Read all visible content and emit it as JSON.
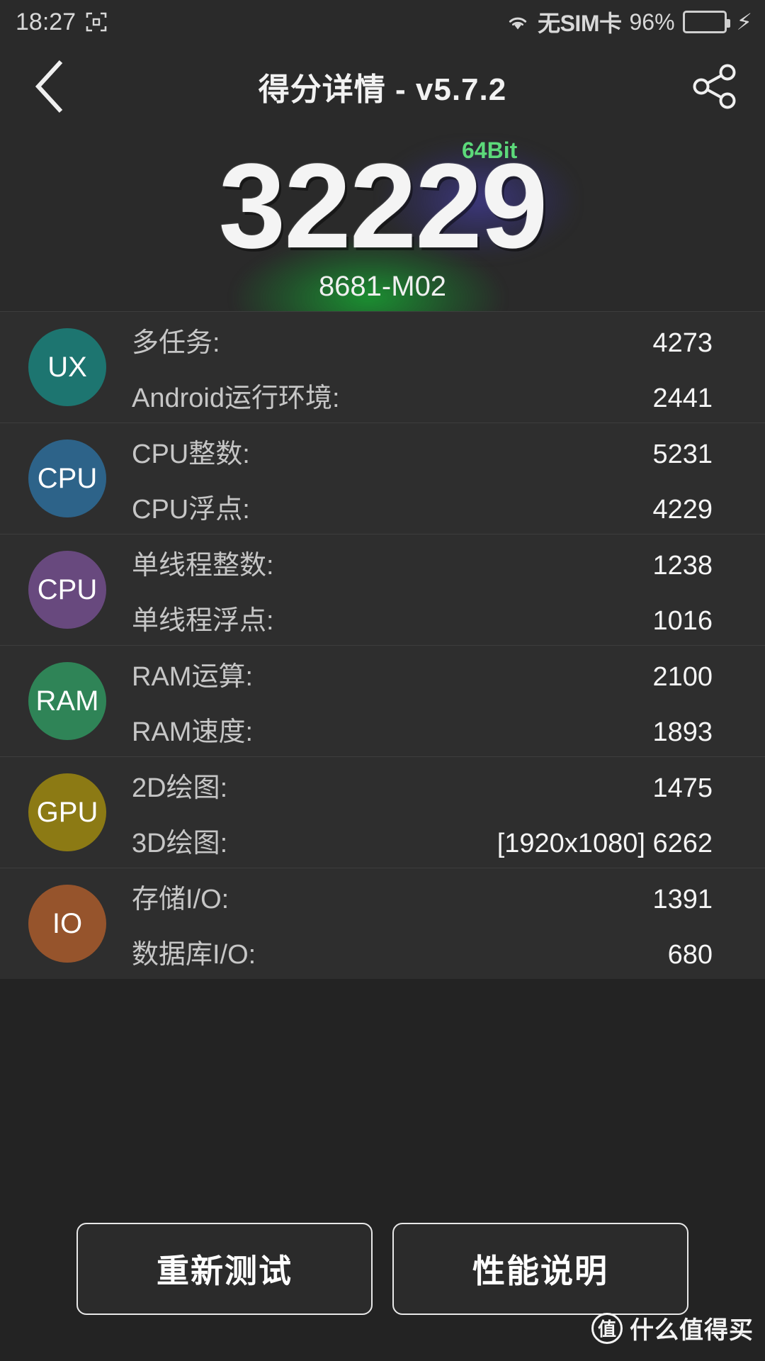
{
  "statusbar": {
    "time": "18:27",
    "screenshot_icon": "screenshot-icon",
    "wifi_icon": "wifi-icon",
    "sim_text": "无SIM卡",
    "battery_percent": "96%",
    "battery_level": 96,
    "charging_icon": "lightning-bolt-icon",
    "battery_color": "#19a340"
  },
  "titlebar": {
    "back_icon": "chevron-left-icon",
    "title": "得分详情 - v5.7.2",
    "share_icon": "share-icon"
  },
  "hero": {
    "score": "32229",
    "bit_badge": "64Bit",
    "bit_badge_color": "#5cd97a",
    "device_name": "8681-M02"
  },
  "rows": [
    {
      "badge": "UX",
      "badge_color": "#1d7570",
      "metrics": [
        {
          "label": "多任务:",
          "value": "4273"
        },
        {
          "label": "Android运行环境:",
          "value": "2441"
        }
      ]
    },
    {
      "badge": "CPU",
      "badge_color": "#2d6389",
      "metrics": [
        {
          "label": "CPU整数:",
          "value": "5231"
        },
        {
          "label": "CPU浮点:",
          "value": "4229"
        }
      ]
    },
    {
      "badge": "CPU",
      "badge_color": "#68497e",
      "metrics": [
        {
          "label": "单线程整数:",
          "value": "1238"
        },
        {
          "label": "单线程浮点:",
          "value": "1016"
        }
      ]
    },
    {
      "badge": "RAM",
      "badge_color": "#2f8457",
      "metrics": [
        {
          "label": "RAM运算:",
          "value": "2100"
        },
        {
          "label": "RAM速度:",
          "value": "1893"
        }
      ]
    },
    {
      "badge": "GPU",
      "badge_color": "#8c7a14",
      "metrics": [
        {
          "label": "2D绘图:",
          "value": "1475"
        },
        {
          "label": "3D绘图:",
          "value": "[1920x1080] 6262"
        }
      ]
    },
    {
      "badge": "IO",
      "badge_color": "#96542c",
      "metrics": [
        {
          "label": "存储I/O:",
          "value": "1391"
        },
        {
          "label": "数据库I/O:",
          "value": "680"
        }
      ]
    }
  ],
  "footer": {
    "retest_label": "重新测试",
    "perf_label": "性能说明"
  },
  "watermark": {
    "logo_char": "值",
    "text": "什么值得买"
  }
}
